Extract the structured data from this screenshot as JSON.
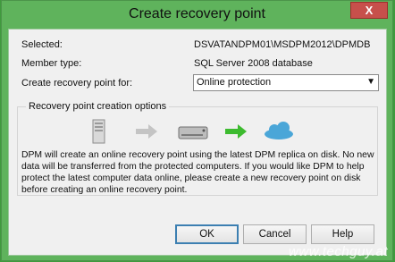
{
  "dialog": {
    "title": "Create recovery point",
    "close_label": "X"
  },
  "fields": {
    "selected_label": "Selected:",
    "selected_value": "DSVATANDPM01\\MSDPM2012\\DPMDB",
    "member_type_label": "Member type:",
    "member_type_value": "SQL Server 2008 database",
    "create_for_label": "Create recovery point for:",
    "create_for_value": "Online protection"
  },
  "options_group": {
    "legend": "Recovery point creation options",
    "icons": [
      "server-icon",
      "gray-arrow-icon",
      "disk-icon",
      "green-arrow-icon",
      "cloud-icon"
    ],
    "description": "DPM will create an online recovery point using the latest DPM replica on disk. No new data will be transferred from the protected computers. If you would like DPM to help protect the latest computer data online, please create a new recovery point on disk before creating an online recovery point."
  },
  "buttons": {
    "ok": "OK",
    "cancel": "Cancel",
    "help": "Help"
  },
  "watermark": "www.techguy.at",
  "colors": {
    "frame": "#5fb35c",
    "close": "#c7504b",
    "default_button_border": "#3c7fb1",
    "green_arrow": "#3dbb2f",
    "cloud": "#4aa6d8"
  }
}
